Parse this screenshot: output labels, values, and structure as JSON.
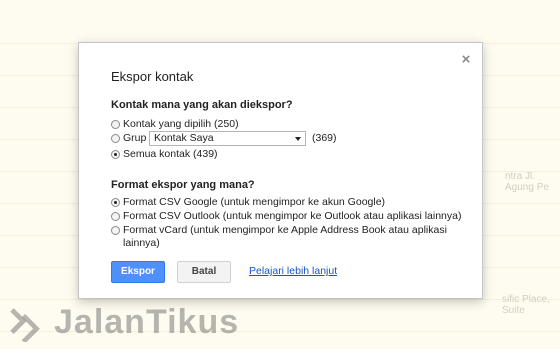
{
  "background": {
    "snippet_1": "ntra Jl. Agung Pe",
    "snippet_2": "sific Place, Suite"
  },
  "dialog": {
    "title": "Ekspor kontak",
    "close_icon": "×",
    "which_contacts": {
      "label": "Kontak mana yang akan diekspor?",
      "options": [
        {
          "label": "Kontak yang dipilih (250)",
          "checked": false
        },
        {
          "label": "Grup",
          "checked": false
        },
        {
          "label": "Semua kontak (439)",
          "checked": true
        }
      ],
      "group_select": {
        "value": "Kontak Saya",
        "count": "(369)"
      }
    },
    "format": {
      "label": "Format ekspor yang mana?",
      "options": [
        {
          "label": "Format CSV Google (untuk mengimpor ke akun Google)",
          "checked": true
        },
        {
          "label": "Format CSV Outlook (untuk mengimpor ke Outlook atau aplikasi lainnya)",
          "checked": false
        },
        {
          "label": "Format vCard (untuk mengimpor ke Apple Address Book atau aplikasi lainnya)",
          "checked": false
        }
      ]
    },
    "buttons": {
      "export": "Ekspor",
      "cancel": "Batal",
      "learn_more": "Pelajari lebih lanjut"
    }
  },
  "watermark": {
    "text": "JalanTikus"
  },
  "colors": {
    "primary_button": "#4d90fe",
    "link": "#1155cc",
    "background": "#fdfbe9"
  }
}
